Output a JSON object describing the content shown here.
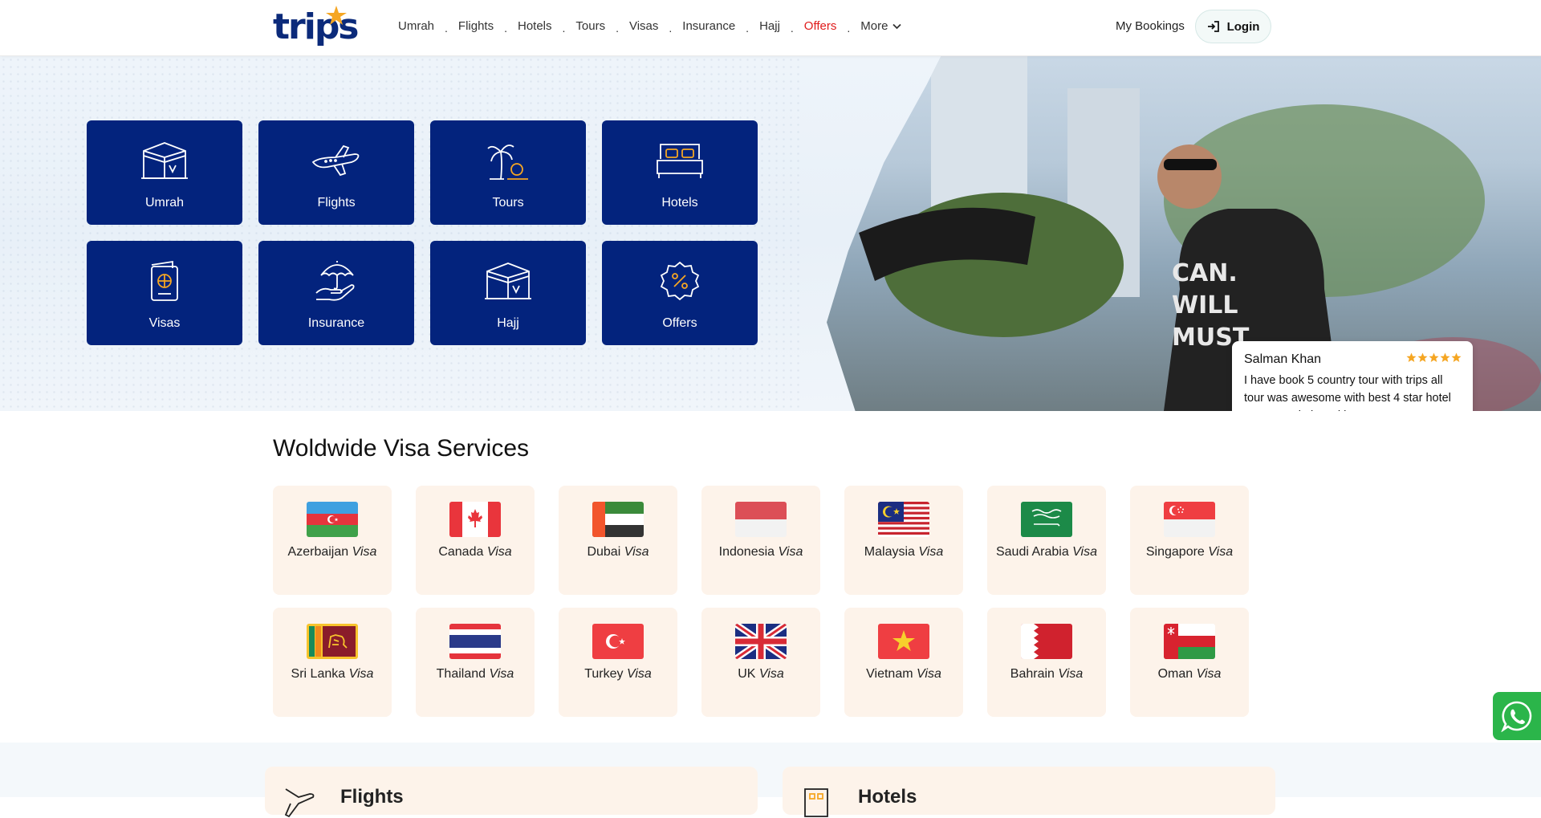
{
  "header": {
    "logo_text": "trips",
    "nav": [
      {
        "label": "Umrah"
      },
      {
        "label": "Flights"
      },
      {
        "label": "Hotels"
      },
      {
        "label": "Tours"
      },
      {
        "label": "Visas"
      },
      {
        "label": "Insurance"
      },
      {
        "label": "Hajj"
      },
      {
        "label": "Offers"
      },
      {
        "label": "More"
      }
    ],
    "my_bookings": "My Bookings",
    "login": "Login"
  },
  "hero": {
    "tiles": [
      {
        "label": "Umrah",
        "icon": "kaaba-icon"
      },
      {
        "label": "Flights",
        "icon": "airplane-icon"
      },
      {
        "label": "Tours",
        "icon": "palm-tree-icon"
      },
      {
        "label": "Hotels",
        "icon": "bed-icon"
      },
      {
        "label": "Visas",
        "icon": "passport-icon"
      },
      {
        "label": "Insurance",
        "icon": "umbrella-hand-icon"
      },
      {
        "label": "Hajj",
        "icon": "kaaba-icon"
      },
      {
        "label": "Offers",
        "icon": "percent-badge-icon"
      }
    ],
    "review": {
      "name": "Salman Khan",
      "rating": 5,
      "text": "I have book 5 country tour with trips all tour was awesome with best 4 star hotel accommodation without any worry."
    }
  },
  "visa": {
    "title": "Woldwide Visa Services",
    "suffix": "Visa",
    "countries": [
      {
        "name": "Azerbaijan"
      },
      {
        "name": "Canada"
      },
      {
        "name": "Dubai"
      },
      {
        "name": "Indonesia"
      },
      {
        "name": "Malaysia"
      },
      {
        "name": "Saudi Arabia"
      },
      {
        "name": "Singapore"
      },
      {
        "name": "Sri Lanka"
      },
      {
        "name": "Thailand"
      },
      {
        "name": "Turkey"
      },
      {
        "name": "UK"
      },
      {
        "name": "Vietnam"
      },
      {
        "name": "Bahrain"
      },
      {
        "name": "Oman"
      }
    ]
  },
  "panels": {
    "flights": "Flights",
    "hotels": "Hotels"
  },
  "colors": {
    "brand_navy": "#03237d",
    "offers_red": "#e01b1b",
    "card_bg": "#fdf3ea",
    "logo_orange": "#f5a623",
    "whatsapp_green": "#2bb54a"
  }
}
